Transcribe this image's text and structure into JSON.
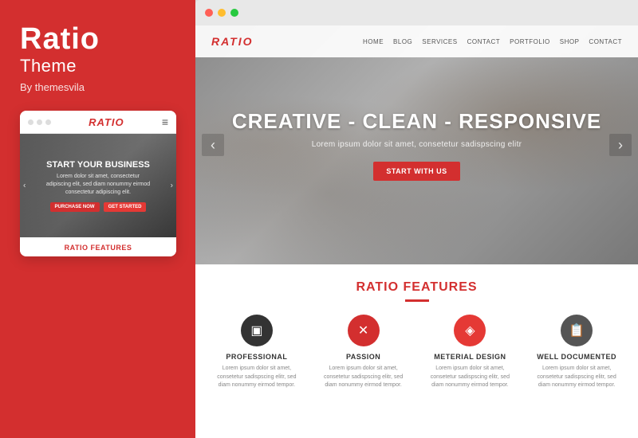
{
  "left": {
    "title": "Ratio",
    "subtitle": "Theme",
    "by": "By themesvila",
    "mobile": {
      "logo": "RATIO",
      "hero_title": "START YOUR BUSINESS",
      "hero_sub": "Lorem dolor sit amet, consectetur\nadipiscing elit, sed diam nonummy eimod\nconsectetur adipiscing elit.",
      "btn1": "PURCHASE NOW",
      "btn2": "GET STARTED"
    },
    "features_label": "RATIO",
    "features_label2": "FEATURES"
  },
  "right": {
    "nav": {
      "logo": "RATIO",
      "items": [
        "HOME",
        "BLOG",
        "SERVICES",
        "CONTACT",
        "PORTFOLIO",
        "SHOP",
        "CONTACT"
      ]
    },
    "hero": {
      "title": "CREATIVE - CLEAN - RESPONSIVE",
      "sub": "Lorem ipsum dolor sit amet, consetetur sadispscing elitr",
      "cta": "START WITH US"
    },
    "features": {
      "label1": "RATIO",
      "label2": "FEATURES",
      "items": [
        {
          "icon": "▣",
          "name": "PROFESSIONAL",
          "desc": "Lorem ipsum dolor sit amet, consetetur sadispscing elitr, sed diam nonummy eirmod tempor."
        },
        {
          "icon": "✿",
          "name": "PASSION",
          "desc": "Lorem ipsum dolor sit amet, consetetur sadispscing elitr, sed diam nonummy eirmod tempor."
        },
        {
          "icon": "◈",
          "name": "METERIAL DESIGN",
          "desc": "Lorem ipsum dolor sit amet, consetetur sadispscing elitr, sed diam nonummy eirmod tempor."
        },
        {
          "icon": "📋",
          "name": "WELL DOCUMENTED",
          "desc": "Lorem ipsum dolor sit amet, consetetur sadispscing elitr, sed diam nonummy eirmod tempor."
        }
      ]
    }
  },
  "colors": {
    "red": "#d32f2f",
    "dark": "#333333",
    "light_gray": "#f5f5f5"
  }
}
